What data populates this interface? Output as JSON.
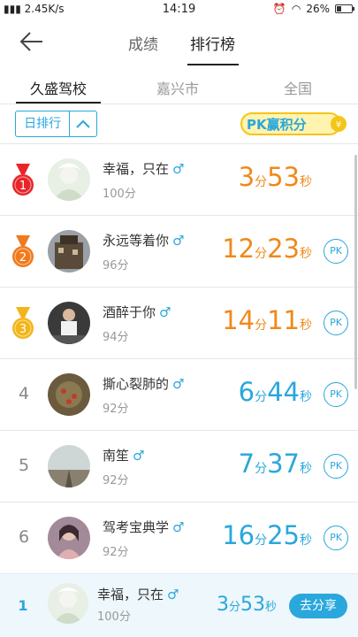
{
  "status_bar": {
    "network_speed": "2.45K/s",
    "time": "14:19",
    "battery_percent": "26%"
  },
  "nav": {
    "tabs": [
      {
        "label": "成绩",
        "active": false
      },
      {
        "label": "排行榜",
        "active": true
      }
    ]
  },
  "subtabs": [
    {
      "label": "久盛驾校",
      "active": true
    },
    {
      "label": "嘉兴市",
      "active": false
    },
    {
      "label": "全国",
      "active": false
    }
  ],
  "filter": {
    "period_label": "日排行",
    "pk_banner_text": "PK赢积分"
  },
  "rankings": [
    {
      "rank": "1",
      "name": "幸福，只在",
      "score": "100分",
      "minutes": "3",
      "seconds": "53",
      "min_unit": "分",
      "sec_unit": "秒",
      "style": "gold",
      "show_pk": false,
      "medal_color": "#e8262a"
    },
    {
      "rank": "2",
      "name": "永远等着你",
      "score": "96分",
      "minutes": "12",
      "seconds": "23",
      "min_unit": "分",
      "sec_unit": "秒",
      "style": "gold",
      "show_pk": true,
      "medal_color": "#f07a1c"
    },
    {
      "rank": "3",
      "name": "酒醉于你",
      "score": "94分",
      "minutes": "14",
      "seconds": "11",
      "min_unit": "分",
      "sec_unit": "秒",
      "style": "gold",
      "show_pk": true,
      "medal_color": "#f2b51a"
    },
    {
      "rank": "4",
      "name": "撕心裂肺的",
      "score": "92分",
      "minutes": "6",
      "seconds": "44",
      "min_unit": "分",
      "sec_unit": "秒",
      "style": "blue",
      "show_pk": true
    },
    {
      "rank": "5",
      "name": "南笙",
      "score": "92分",
      "minutes": "7",
      "seconds": "37",
      "min_unit": "分",
      "sec_unit": "秒",
      "style": "blue",
      "show_pk": true
    },
    {
      "rank": "6",
      "name": "驾考宝典学",
      "score": "92分",
      "minutes": "16",
      "seconds": "25",
      "min_unit": "分",
      "sec_unit": "秒",
      "style": "blue",
      "show_pk": true
    }
  ],
  "pk_label": "PK",
  "male_symbol": "♂",
  "my_rank": {
    "rank": "1",
    "name": "幸福，只在",
    "score": "100分",
    "minutes": "3",
    "seconds": "53",
    "min_unit": "分",
    "sec_unit": "秒",
    "share_label": "去分享"
  },
  "colors": {
    "accent_blue": "#2aa7dc",
    "accent_orange": "#f0891a"
  }
}
